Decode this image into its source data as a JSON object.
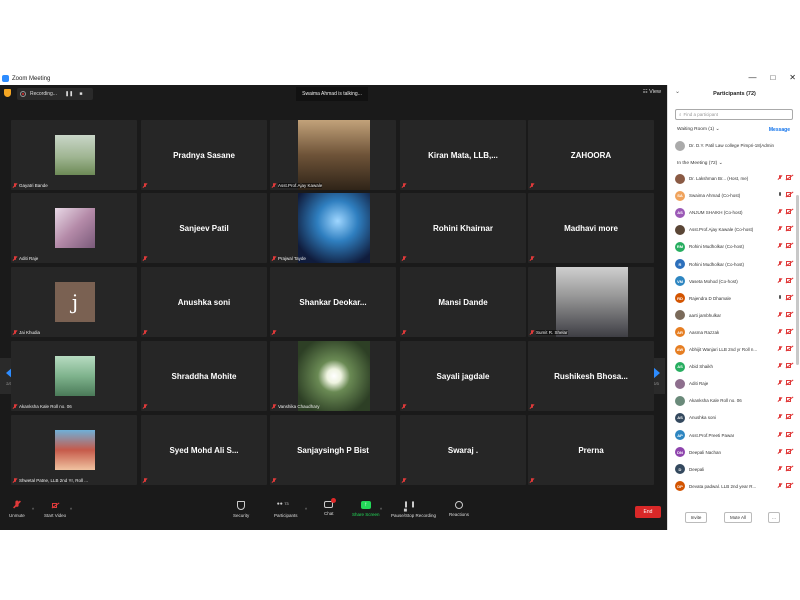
{
  "window": {
    "title": "Zoom Meeting",
    "controls": [
      "—",
      "□",
      "✕"
    ]
  },
  "topbar": {
    "recording": "Recording...",
    "talking": "Swaima Ahmad is talking...",
    "view": "View"
  },
  "grid": {
    "page": "2/3",
    "tiles": [
      {
        "name": "",
        "label": "Gayatri Bande",
        "photo": "landscape"
      },
      {
        "name": "Pradnya Sasane",
        "label": "",
        "photo": ""
      },
      {
        "name": "",
        "label": "Asst.Prof.Ajay Kawale",
        "photo": "group"
      },
      {
        "name": "Kiran Mata, LLB,...",
        "label": "",
        "photo": ""
      },
      {
        "name": "ZAHOORA",
        "label": "",
        "photo": ""
      },
      {
        "name": "",
        "label": "Aditi Raje",
        "photo": "pink"
      },
      {
        "name": "Sanjeev Patil",
        "label": "",
        "photo": ""
      },
      {
        "name": "",
        "label": "Prajwal Tayde",
        "photo": "anime"
      },
      {
        "name": "Rohini Khairnar",
        "label": "",
        "photo": ""
      },
      {
        "name": "Madhavi more",
        "label": "",
        "photo": ""
      },
      {
        "name": "",
        "label": "Jai Khudia",
        "photo": "letter",
        "letter": "j"
      },
      {
        "name": "Anushka soni",
        "label": "",
        "photo": ""
      },
      {
        "name": "Shankar  Deokar...",
        "label": "",
        "photo": ""
      },
      {
        "name": "Mansi Dande",
        "label": "",
        "photo": ""
      },
      {
        "name": "",
        "label": "Sumit R. Shelar",
        "photo": "person"
      },
      {
        "name": "",
        "label": "Akanksha Kale Roll no. 06",
        "photo": "girl"
      },
      {
        "name": "Shraddha Mohite",
        "label": "",
        "photo": ""
      },
      {
        "name": "",
        "label": "Vanshika Chaudhary",
        "photo": "flower"
      },
      {
        "name": "Sayali jagdale",
        "label": "",
        "photo": ""
      },
      {
        "name": "Rushikesh  Bhosa...",
        "label": "",
        "photo": ""
      },
      {
        "name": "",
        "label": "Shwetal Patne, LLB 2nd Yr, Roll ...",
        "photo": "family"
      },
      {
        "name": "Syed Mohd Ali S...",
        "label": "",
        "photo": ""
      },
      {
        "name": "Sanjaysingh P Bist",
        "label": "",
        "photo": ""
      },
      {
        "name": "Swaraj .",
        "label": "",
        "photo": ""
      },
      {
        "name": "Prerna",
        "label": "",
        "photo": ""
      }
    ]
  },
  "toolbar": {
    "unmute": "Unmute",
    "start_video": "Start Video",
    "security": "Security",
    "participants": "Participants",
    "participants_count": "73",
    "chat": "Chat",
    "share": "Share Screen",
    "pause": "Pause/Stop Recording",
    "reactions": "Reactions",
    "end": "End",
    "colors": {
      "end": "#d92828",
      "share": "#23d959"
    }
  },
  "panel": {
    "title": "Participants (72)",
    "search_placeholder": "Find a participant",
    "waiting_room": "Waiting Room (1)",
    "message": "Message",
    "waiting_person": "Dr. D.Y. Patil Law college Pimpri-18(Admin",
    "in_meeting": "In the Meeting (72)",
    "participants": [
      {
        "name": "Dr. Lakshman Br... (Host, me)",
        "initials": "",
        "color": "#8a5a44",
        "mic": "off",
        "cam": "off"
      },
      {
        "name": "Swaima Ahmad (Co-host)",
        "initials": "SA",
        "color": "#f0a35c",
        "mic": "on",
        "cam": "off"
      },
      {
        "name": "ANJUM SHAIKH (Co-host)",
        "initials": "AS",
        "color": "#9b59b6",
        "mic": "off",
        "cam": "off"
      },
      {
        "name": "Asst.Prof.Ajay Kawale (Co-host)",
        "initials": "",
        "color": "#5a4636",
        "mic": "off",
        "cam": "off"
      },
      {
        "name": "Rohini Mudholkar (Co-host)",
        "initials": "RM",
        "color": "#27ae60",
        "mic": "off",
        "cam": "off"
      },
      {
        "name": "Rohini Mudholkar (Co-host)",
        "initials": "R",
        "color": "#2c6fbb",
        "mic": "off",
        "cam": "off"
      },
      {
        "name": "Vaseta Mohod (Co-host)",
        "initials": "VM",
        "color": "#2e86c1",
        "mic": "off",
        "cam": "off"
      },
      {
        "name": "Rajendra D Dhamale",
        "initials": "RD",
        "color": "#d35400",
        "mic": "on",
        "cam": "off"
      },
      {
        "name": "aarti jambhulkar",
        "initials": "",
        "color": "#7a6a5a",
        "mic": "off",
        "cam": "off"
      },
      {
        "name": "Aasma Razzak",
        "initials": "AR",
        "color": "#e67e22",
        "mic": "off",
        "cam": "off"
      },
      {
        "name": "Abhijit Wanjari LLB 2nd yr Roll n...",
        "initials": "AW",
        "color": "#e67e22",
        "mic": "off",
        "cam": "off"
      },
      {
        "name": "Abid Shaikh",
        "initials": "AS",
        "color": "#27ae60",
        "mic": "off",
        "cam": "off"
      },
      {
        "name": "Aditi Raje",
        "initials": "",
        "color": "#8e6f8e",
        "mic": "off",
        "cam": "off"
      },
      {
        "name": "Akanksha Kale Roll no. 06",
        "initials": "",
        "color": "#6a8a7a",
        "mic": "off",
        "cam": "off"
      },
      {
        "name": "Anushka soni",
        "initials": "AS",
        "color": "#34495e",
        "mic": "off",
        "cam": "off"
      },
      {
        "name": "Asst.Prof.Preeti Pawar",
        "initials": "AP",
        "color": "#2e86c1",
        "mic": "off",
        "cam": "off"
      },
      {
        "name": "Deepali Nachan",
        "initials": "DN",
        "color": "#8e44ad",
        "mic": "off",
        "cam": "off"
      },
      {
        "name": "Deepali",
        "initials": "D",
        "color": "#34495e",
        "mic": "off",
        "cam": "off"
      },
      {
        "name": "Devata padwal. LLB 2nd year R...",
        "initials": "DP",
        "color": "#d35400",
        "mic": "off",
        "cam": "off"
      }
    ],
    "invite": "Invite",
    "mute_all": "Mute All",
    "more": "..."
  }
}
